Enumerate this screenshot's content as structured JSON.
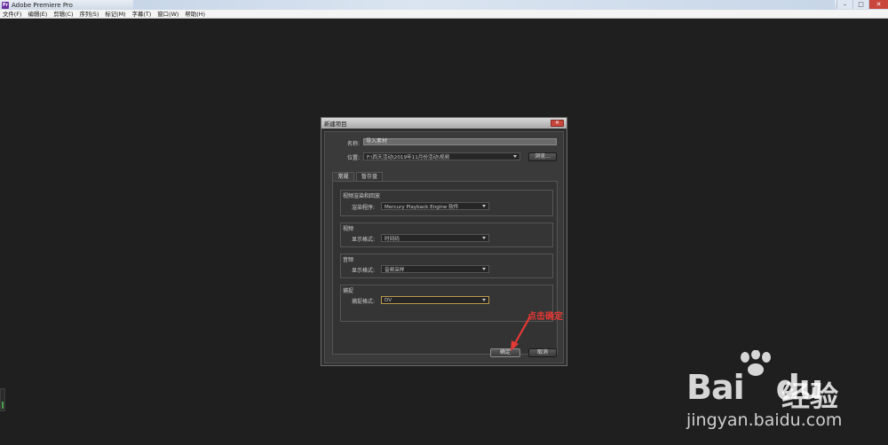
{
  "app": {
    "title": "Adobe Premiere Pro",
    "icon_glyph": "Pr"
  },
  "window_controls": {
    "minimize": "–",
    "maximize": "□",
    "close": "✕"
  },
  "menu": [
    "文件(F)",
    "编辑(E)",
    "剪辑(C)",
    "序列(S)",
    "标记(M)",
    "字幕(T)",
    "窗口(W)",
    "帮助(H)"
  ],
  "dialog": {
    "title": "新建项目",
    "close_glyph": "✕",
    "name_label": "名称:",
    "name_value": "导入素材",
    "location_label": "位置:",
    "location_value": "F:\\西天活动\\2019年11月份活动\\视频",
    "browse_label": "浏览...",
    "tabs": [
      "常规",
      "暂存盘"
    ],
    "groups": {
      "render": {
        "title": "视频渲染和回放",
        "field_label": "渲染程序:",
        "value": "Mercury Playback Engine 软件"
      },
      "video": {
        "title": "视频",
        "field_label": "显示格式:",
        "value": "时间码"
      },
      "audio": {
        "title": "音频",
        "field_label": "显示格式:",
        "value": "音频采样"
      },
      "capture": {
        "title": "捕捉",
        "field_label": "捕捉格式:",
        "value": "DV"
      }
    },
    "ok_label": "确定",
    "cancel_label": "取消"
  },
  "annotation": {
    "text": "点击确定",
    "color": "#e53935"
  },
  "watermark": {
    "brand": "Bai",
    "brand_suffix": "du",
    "cn": "经验",
    "url": "jingyan.baidu.com"
  },
  "colors": {
    "background": "#1f1f1f",
    "dialog": "#2e2e2e",
    "accent": "#b89a4a"
  }
}
